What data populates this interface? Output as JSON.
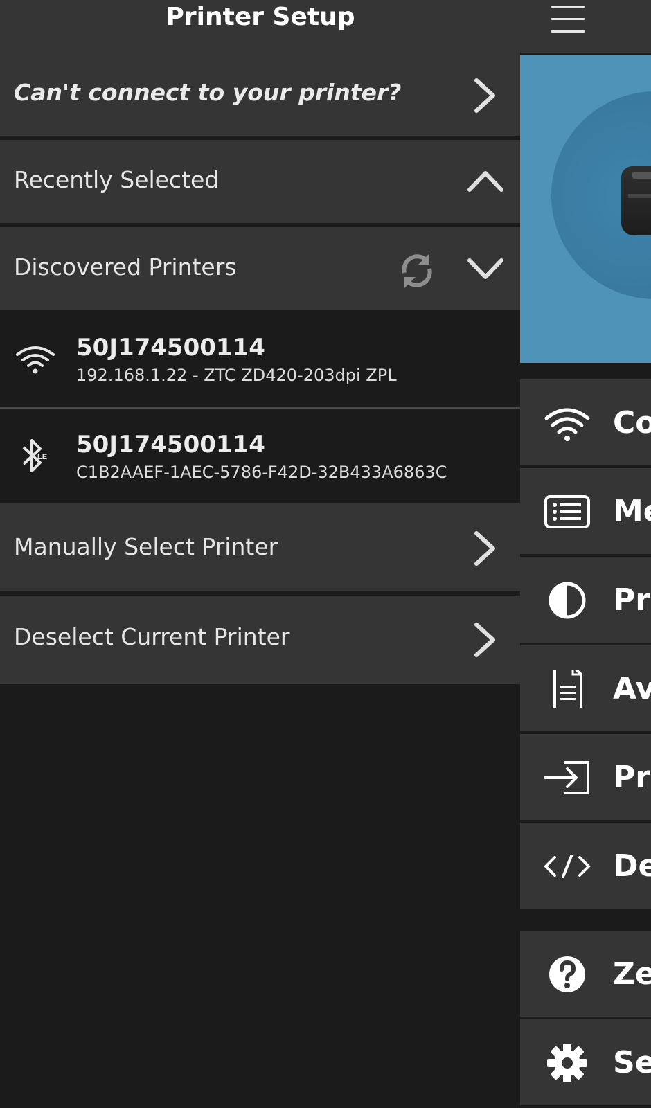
{
  "header": {
    "title": "Printer Setup",
    "menu_icon": "hamburger-icon"
  },
  "sidebar": {
    "cant_connect": {
      "label": "Can't connect to your printer?",
      "icon": "chevron-right-icon"
    },
    "recently_selected": {
      "label": "Recently Selected",
      "icon": "chevron-up-icon"
    },
    "discovered": {
      "label": "Discovered Printers",
      "refresh_icon": "refresh-icon",
      "icon": "chevron-down-icon"
    },
    "printers": [
      {
        "name": "50J174500114",
        "detail": "192.168.1.22 - ZTC ZD420-203dpi ZPL",
        "icon": "wifi-icon"
      },
      {
        "name": "50J174500114",
        "detail": "C1B2AAEF-1AEC-5786-F42D-32B433A6863C",
        "icon": "bluetooth-le-icon",
        "icon_badge": "LE"
      }
    ],
    "manual_select": {
      "label": "Manually Select Printer",
      "icon": "chevron-right-icon"
    },
    "deselect": {
      "label": "Deselect Current Printer",
      "icon": "chevron-right-icon"
    }
  },
  "menu": {
    "items": [
      {
        "label": "Co",
        "icon": "wifi-icon"
      },
      {
        "label": "Me",
        "icon": "list-icon"
      },
      {
        "label": "Pri",
        "icon": "contrast-icon"
      },
      {
        "label": "Ava",
        "icon": "document-icon"
      },
      {
        "label": "Pri",
        "icon": "sign-in-icon"
      },
      {
        "label": "De",
        "icon": "code-icon"
      },
      {
        "label": "Ze",
        "icon": "help-icon"
      },
      {
        "label": "Se",
        "icon": "gear-icon"
      }
    ]
  },
  "colors": {
    "panel": "#353536",
    "background": "#1b1b1c",
    "hero": "#4f93b9",
    "text": "#e6e6e6"
  }
}
